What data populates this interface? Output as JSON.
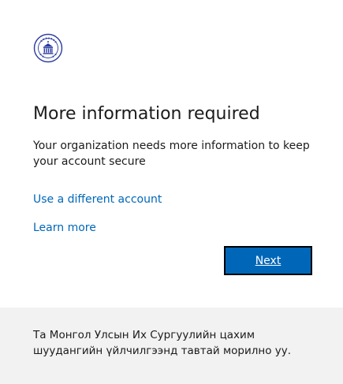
{
  "header": {
    "logo_icon": "university-seal-icon",
    "brand_color": "#2a3a9e"
  },
  "main": {
    "title": "More information required",
    "description": "Your organization needs more information to keep your account secure",
    "links": {
      "different_account": "Use a different account",
      "learn_more": "Learn more"
    },
    "next_label": "Next"
  },
  "footer": {
    "text": "Та Монгол Улсын Их Сургуулийн цахим шуудангийн үйлчилгээнд тавтай морилно уу."
  },
  "colors": {
    "accent": "#0067b8",
    "text": "#1b1b1b",
    "footer_bg": "#f2f2f2",
    "button_border": "#000000"
  }
}
